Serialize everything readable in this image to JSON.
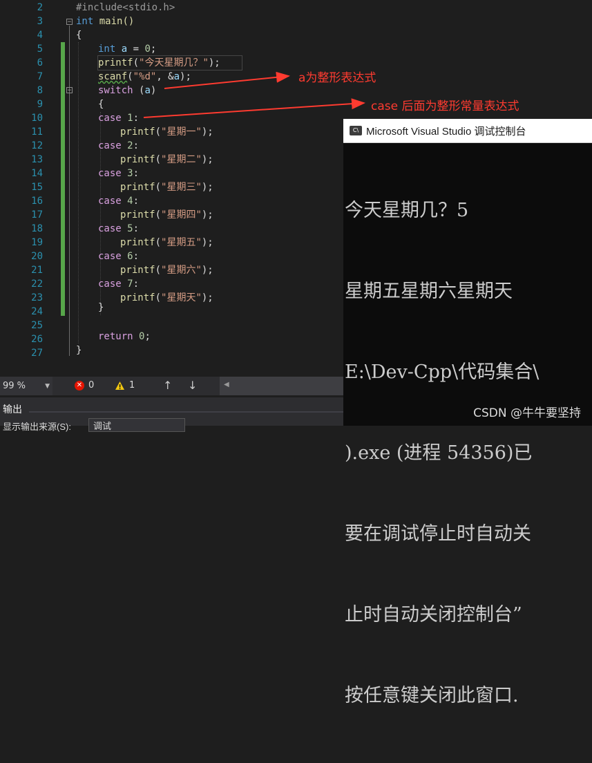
{
  "editor": {
    "line_numbers": [
      "2",
      "3",
      "4",
      "5",
      "6",
      "7",
      "8",
      "9",
      "10",
      "11",
      "12",
      "13",
      "14",
      "15",
      "16",
      "17",
      "18",
      "19",
      "20",
      "21",
      "22",
      "23",
      "24",
      "25",
      "26",
      "27"
    ],
    "code": {
      "l2": "#include<stdio.h>",
      "l3_kw": "int",
      "l3_rest": " main()",
      "l4": "{",
      "l5_kw": "int",
      "l5_var": " a",
      "l5_eq": " = ",
      "l5_num": "0",
      "l5_end": ";",
      "l6_fn": "printf",
      "l6_open": "(",
      "l6_str": "\"今天星期几？\"",
      "l6_close": ");",
      "l7_fn": "scanf",
      "l7_open": "(",
      "l7_str": "\"%d\"",
      "l7_mid": ", &",
      "l7_var": "a",
      "l7_close": ");",
      "l8_kw": "switch",
      "l8_open": " (",
      "l8_var": "a",
      "l8_close": ")",
      "l9": "{",
      "cases": [
        {
          "kw": "case",
          "num": " 1",
          "colon": ":",
          "fn": "printf",
          "str": "\"星期一\""
        },
        {
          "kw": "case",
          "num": " 2",
          "colon": ":",
          "fn": "printf",
          "str": "\"星期二\""
        },
        {
          "kw": "case",
          "num": " 3",
          "colon": ":",
          "fn": "printf",
          "str": "\"星期三\""
        },
        {
          "kw": "case",
          "num": " 4",
          "colon": ":",
          "fn": "printf",
          "str": "\"星期四\""
        },
        {
          "kw": "case",
          "num": " 5",
          "colon": ":",
          "fn": "printf",
          "str": "\"星期五\""
        },
        {
          "kw": "case",
          "num": " 6",
          "colon": ":",
          "fn": "printf",
          "str": "\"星期六\""
        },
        {
          "kw": "case",
          "num": " 7",
          "colon": ":",
          "fn": "printf",
          "str": "\"星期天\""
        }
      ],
      "paren_open": "(",
      "paren_close": ");",
      "l24": "}",
      "l26_kw": "return",
      "l26_num": " 0",
      "l26_end": ";",
      "l27": "}"
    }
  },
  "annotations": {
    "a_expr": "a为整形表达式",
    "case_expr": "case 后面为整形常量表达式",
    "color": "#ff3b30"
  },
  "status": {
    "zoom": "99 %",
    "errors": "0",
    "warnings": "1"
  },
  "output_panel": {
    "title": "输出",
    "source_label": "显示输出来源(S):",
    "source_value": "调试"
  },
  "console": {
    "title": "Microsoft Visual Studio 调试控制台",
    "lines": [
      "今天星期几？5",
      "星期五星期六星期天",
      "E:\\Dev-Cpp\\代码集合\\",
      ").exe (进程 54356)已",
      "要在调试停止时自动关",
      "止时自动关闭控制台”",
      "按任意键关闭此窗口."
    ]
  },
  "watermark": "CSDN @牛牛要坚持",
  "colors": {
    "editor_bg": "#1e1e1e",
    "keyword": "#569cd6",
    "control_keyword": "#d8a0df",
    "function": "#dcdcaa",
    "string": "#d69d85",
    "number": "#b5cea8",
    "variable": "#9cdcfe",
    "line_number": "#2b91af",
    "change_bar": "#57a64a"
  }
}
